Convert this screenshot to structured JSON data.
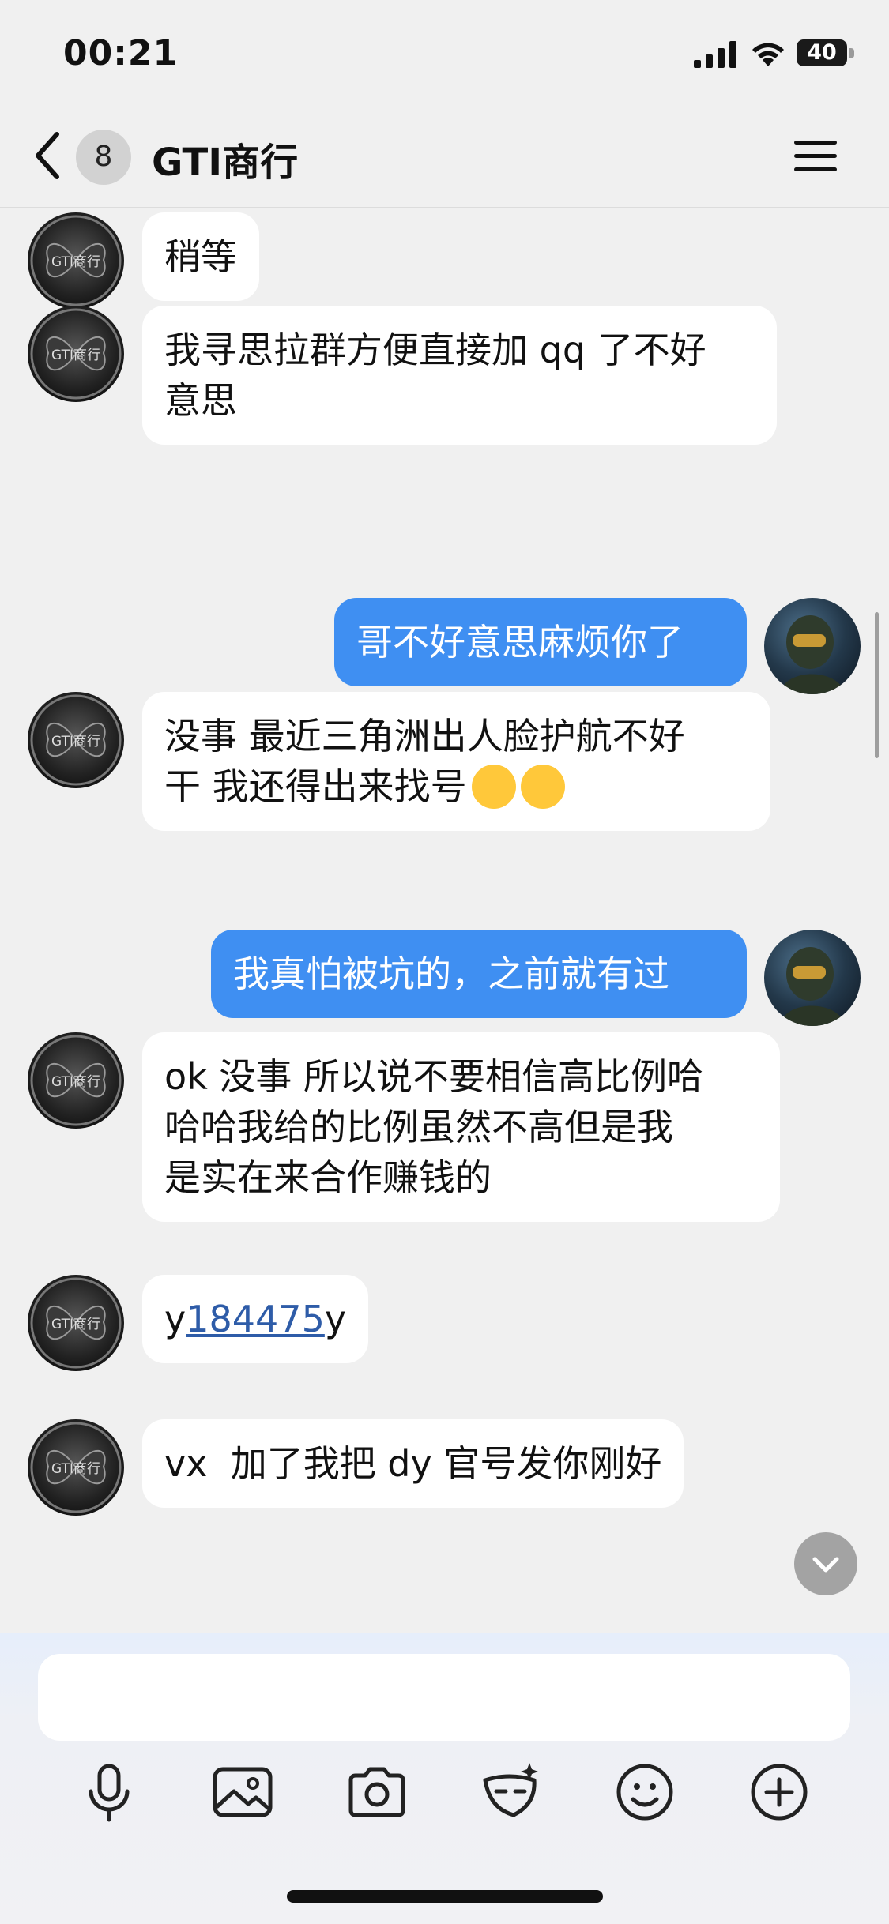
{
  "status_bar": {
    "time": "00:21",
    "battery": "40",
    "battery_level": 0.4
  },
  "nav": {
    "unread_count": "8",
    "title": "GTI商行"
  },
  "contact_avatar_text": "GTI商行",
  "messages": [
    {
      "side": "in",
      "text": "稍等"
    },
    {
      "side": "in",
      "text": "我寻思拉群方便直接加 qq 了不好\n意思"
    },
    {
      "side": "out",
      "text": "哥不好意思麻烦你了"
    },
    {
      "side": "in",
      "text": "没事 最近三角洲出人脸护航不好\n干 我还得出来找号",
      "emoji": "joy-emoji"
    },
    {
      "side": "out",
      "text": "我真怕被坑的，之前就有过"
    },
    {
      "side": "in",
      "text": "ok 没事 所以说不要相信高比例哈\n哈哈我给的比例虽然不高但是我\n是实在来合作赚钱的"
    },
    {
      "side": "in",
      "text_pre": "y",
      "link": "184475",
      "text_post": "y"
    },
    {
      "side": "in",
      "text": "vx  加了我把 dy 官号发你刚好"
    }
  ],
  "input": {
    "value": "",
    "placeholder": ""
  },
  "toolbar": [
    "mic-icon",
    "image-icon",
    "camera-icon",
    "sticker-icon",
    "emoji-icon",
    "plus-icon"
  ]
}
